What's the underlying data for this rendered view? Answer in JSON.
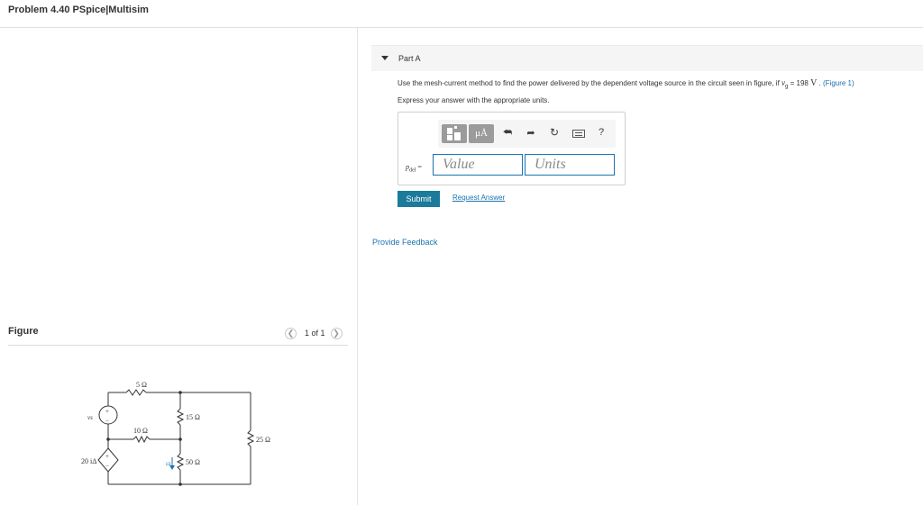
{
  "header": {
    "title": "Problem 4.40 PSpice|Multisim"
  },
  "figure": {
    "label": "Figure",
    "pager": {
      "prev_icon": "chevron-left-icon",
      "text": "1 of 1",
      "next_icon": "chevron-right-icon"
    },
    "circuit": {
      "labels": {
        "r5": "5 Ω",
        "r15": "15 Ω",
        "r10": "10 Ω",
        "r25": "25 Ω",
        "r50": "50 Ω",
        "vs": "vs",
        "dep_source": "20 iΔ",
        "current": "iΔ",
        "plus": "+",
        "minus": "−"
      }
    }
  },
  "part": {
    "title": "Part A",
    "question": {
      "pre": "Use the mesh-current method to find the power delivered by the dependent voltage source in the circuit seen in figure, if ",
      "var": "v",
      "sub": "g",
      "eq": " = 198 ",
      "unit": "V",
      "post": " .",
      "link": "(Figure 1)"
    },
    "instruction": "Express your answer with the appropriate units.",
    "toolbar": {
      "mu_label": "μÅ",
      "undo_icon": "undo-icon",
      "redo_icon": "redo-icon",
      "reset_icon": "reset-icon",
      "keyboard_icon": "keyboard-icon",
      "help_label": "?"
    },
    "answer": {
      "label_var": "p",
      "label_sub": "del",
      "label_eq": " =",
      "value_placeholder": "Value",
      "units_placeholder": "Units"
    },
    "submit_label": "Submit",
    "request_label": "Request Answer",
    "feedback_label": "Provide Feedback"
  }
}
